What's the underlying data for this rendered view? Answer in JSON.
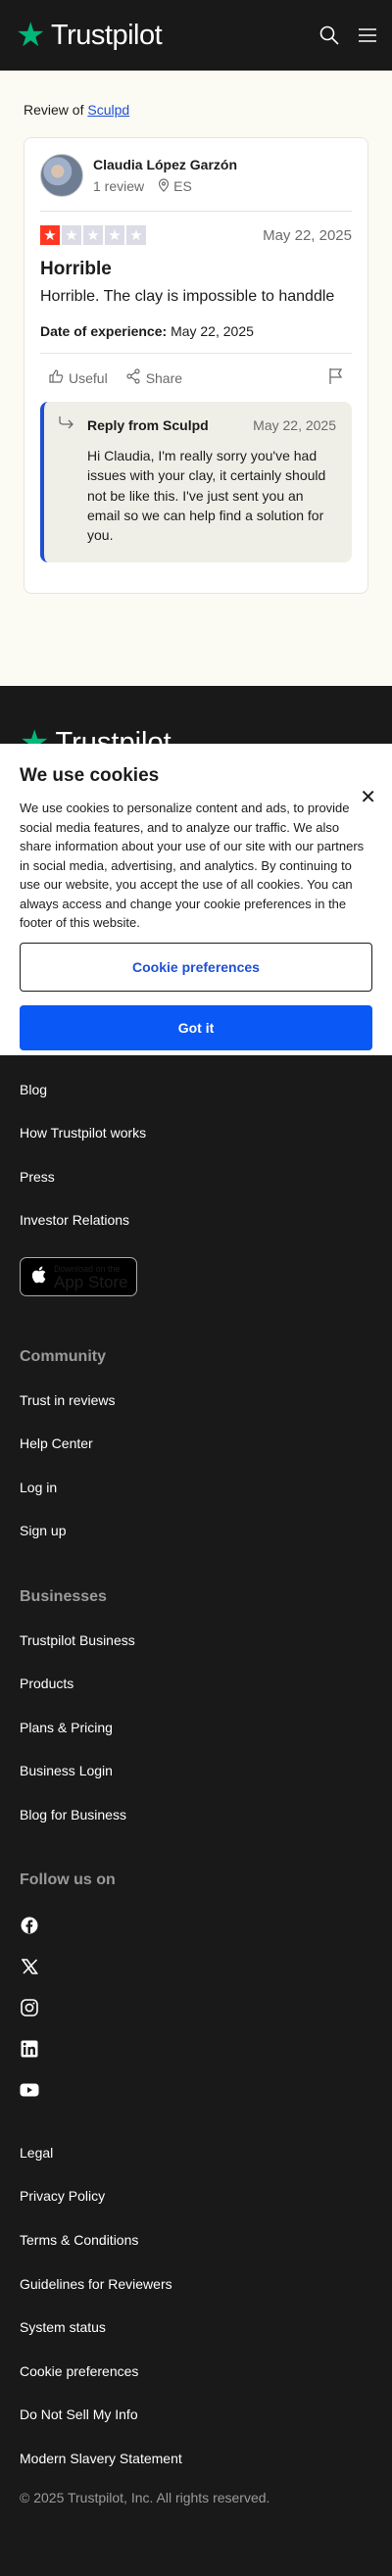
{
  "header": {
    "brand": "Trustpilot"
  },
  "review_of": {
    "prefix": "Review of",
    "company": "Sculpd"
  },
  "review": {
    "reviewer_name": "Claudia López Garzón",
    "review_count": "1 review",
    "country": "ES",
    "rating": 1,
    "date": "May 22, 2025",
    "title": "Horrible",
    "text": "Horrible. The clay is impossible to handdle",
    "experience_label": "Date of experience:",
    "experience_date": "May 22, 2025",
    "useful_label": "Useful",
    "share_label": "Share"
  },
  "reply": {
    "title": "Reply from Sculpd",
    "date": "May 22, 2025",
    "text": "Hi Claudia, I'm really sorry you've had issues with your clay, it certainly should not be like this. I've just sent you an email so we can help find a solution for you."
  },
  "cookie": {
    "title": "We use cookies",
    "text": "We use cookies to personalize content and ads, to provide social media features, and to analyze our traffic. We also share information about your use of our site with our partners in social media, advertising, and analytics. By continuing to use our website, you accept the use of all cookies. You can always access and change your cookie preferences in the footer of this website.",
    "pref_button": "Cookie preferences",
    "got_button": "Got it"
  },
  "footer": {
    "brand": "Trustpilot",
    "links_top": [
      "Blog",
      "How Trustpilot works",
      "Press",
      "Investor Relations"
    ],
    "appstore": {
      "line1": "Download on the",
      "line2": "App Store"
    },
    "community_heading": "Community",
    "community": [
      "Trust in reviews",
      "Help Center",
      "Log in",
      "Sign up"
    ],
    "businesses_heading": "Businesses",
    "businesses": [
      "Trustpilot Business",
      "Products",
      "Plans & Pricing",
      "Business Login",
      "Blog for Business"
    ],
    "follow_heading": "Follow us on",
    "social_icons": [
      "facebook-icon",
      "x-icon",
      "instagram-icon",
      "linkedin-icon",
      "youtube-icon"
    ],
    "legal": [
      "Legal",
      "Privacy Policy",
      "Terms & Conditions",
      "Guidelines for Reviewers",
      "System status",
      "Cookie preferences",
      "Do Not Sell My Info",
      "Modern Slavery Statement"
    ],
    "copyright": "© 2025 Trustpilot, Inc. All rights reserved."
  },
  "colors": {
    "brand_green": "#00b67a",
    "star_red": "#ff3722",
    "link_blue": "#1e50d6",
    "button_blue": "#0a58f5"
  }
}
